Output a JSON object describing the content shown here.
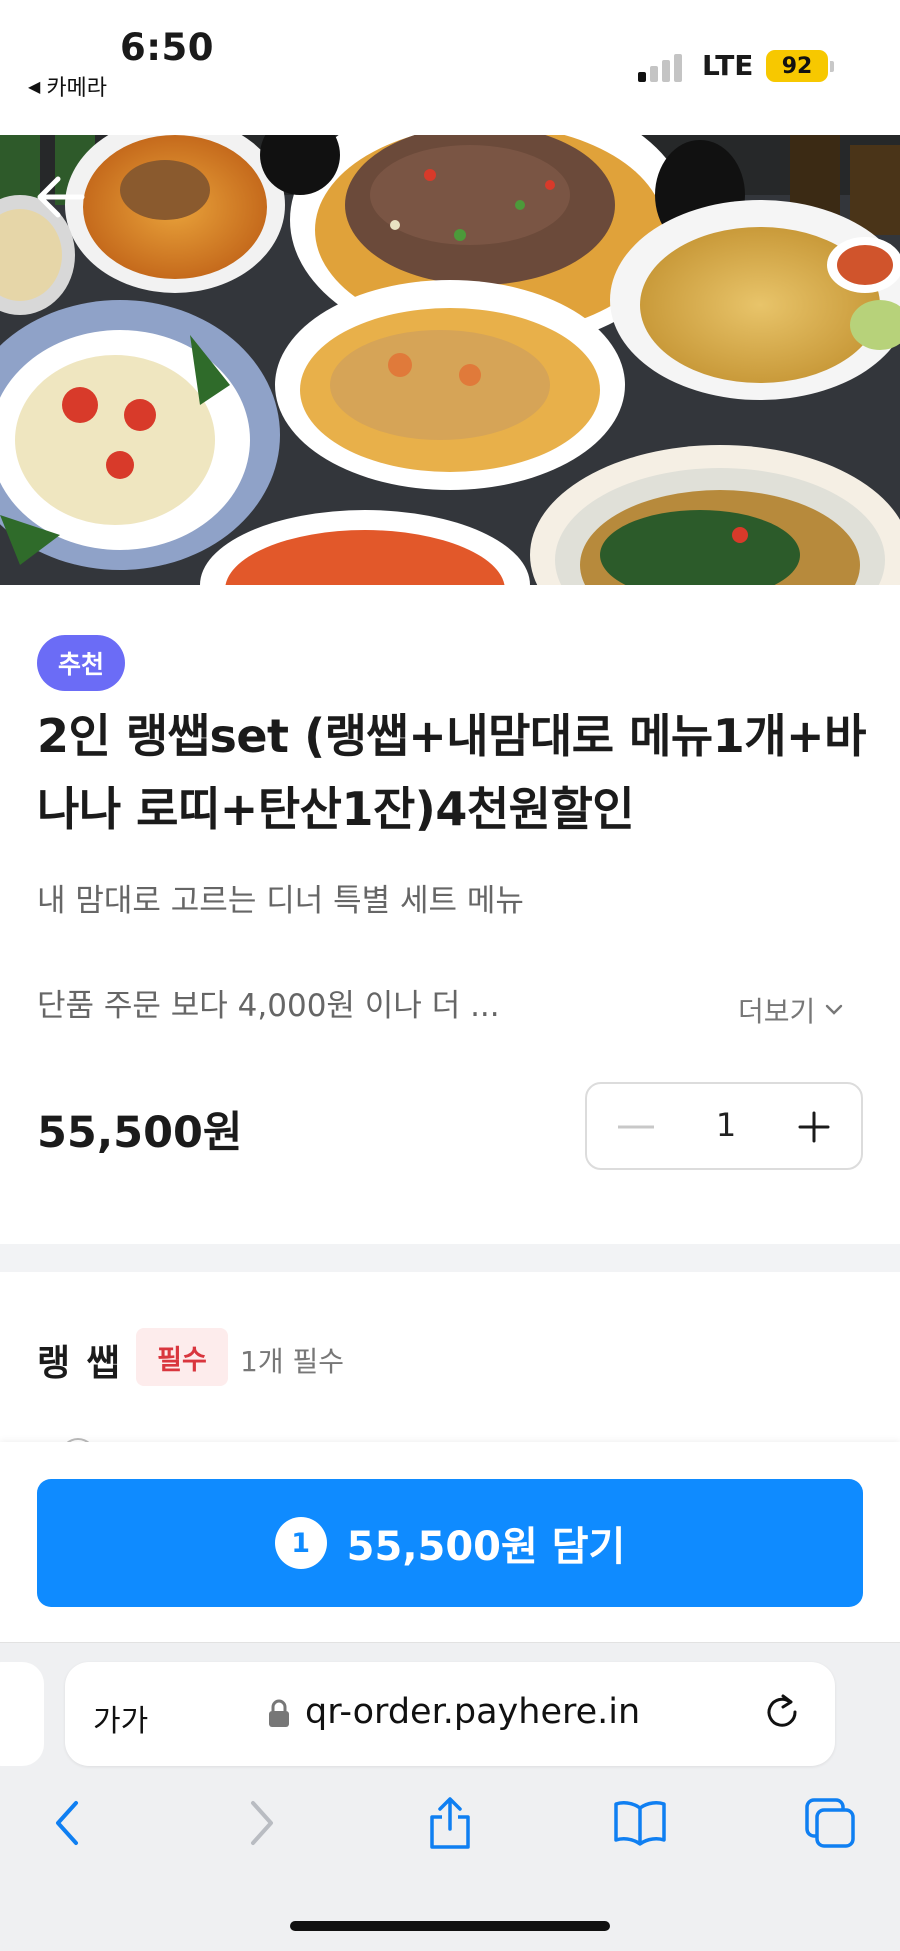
{
  "status_bar": {
    "time": "6:50",
    "back_app_label": "카메라",
    "network": "LTE",
    "battery": "92"
  },
  "hero": {
    "image_description": "Thai food spread photo",
    "back_icon": "arrow-left-icon"
  },
  "product": {
    "badge": "추천",
    "title": "2인 랭쌥set (랭쌥+내맘대로 메뉴1개+바나나 로띠+탄산1잔)4천원할인",
    "description": "내 맘대로 고르는 디너 특별 세트 메뉴",
    "description_more": "단품 주문 보다 4,000원 이나 더 ...",
    "more_label": "더보기",
    "price": "55,500원",
    "quantity": "1"
  },
  "option_section": {
    "title": "랭 쌥",
    "required_badge": "필수",
    "required_note": "1개 필수"
  },
  "cta": {
    "count": "1",
    "label": "55,500원 담기"
  },
  "browser": {
    "text_size_label": "가가",
    "url": "qr-order.payhere.in"
  },
  "colors": {
    "primary": "#0f8bff",
    "badge": "#6b6cf6",
    "required": "#d9363e"
  }
}
